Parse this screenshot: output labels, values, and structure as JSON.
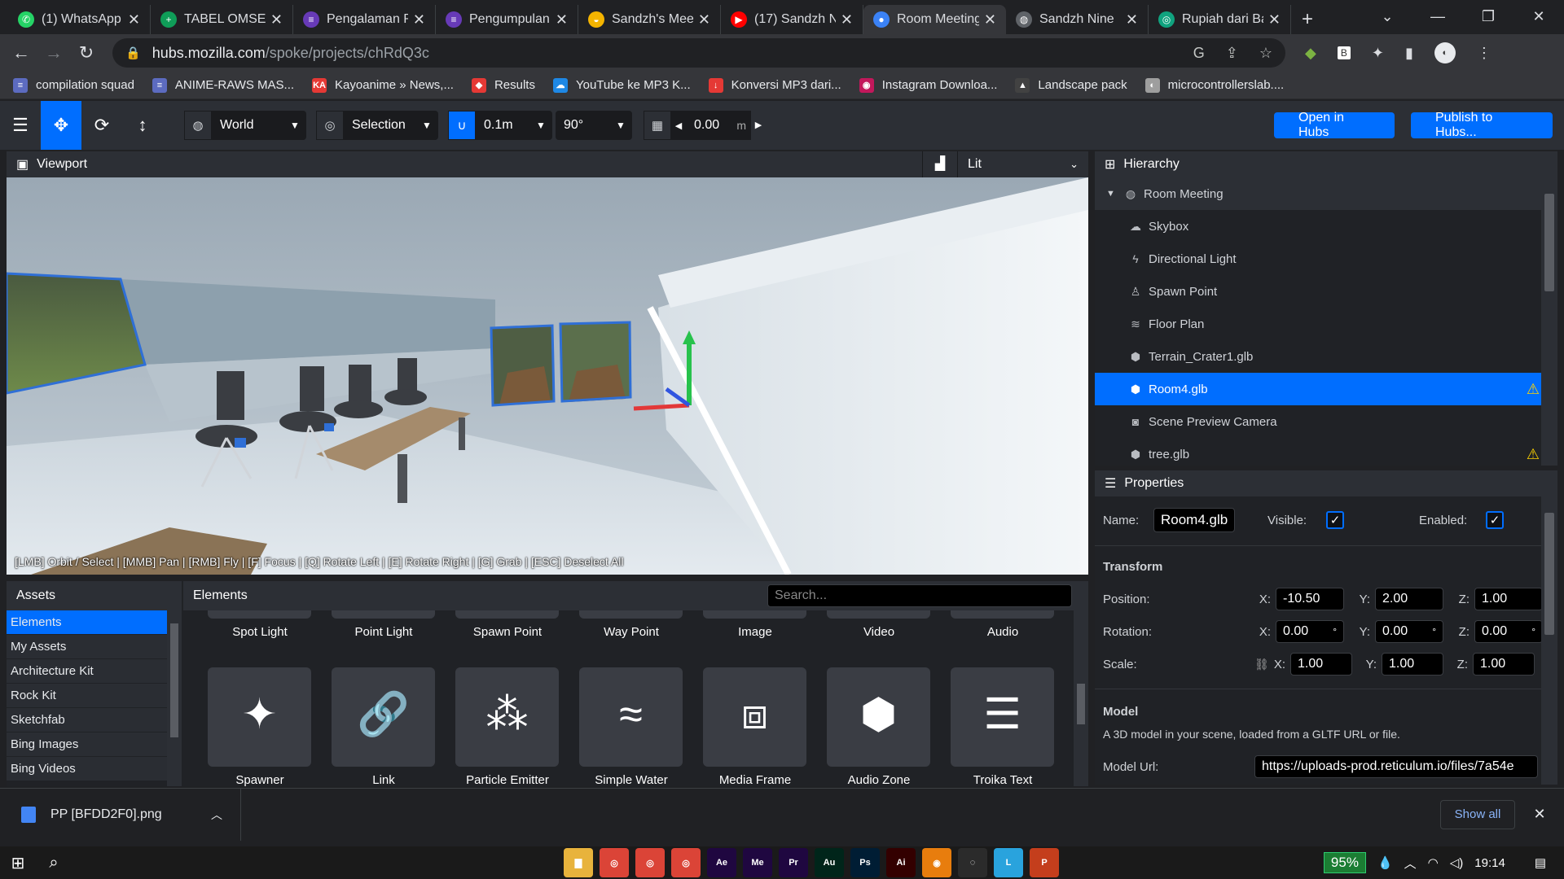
{
  "browser": {
    "tabs": [
      {
        "title": "(1) WhatsApp",
        "color": "#25d366",
        "glyph": "✆"
      },
      {
        "title": "TABEL OMSET",
        "color": "#0f9d58",
        "glyph": "+"
      },
      {
        "title": "Pengalaman R",
        "color": "#673ab7",
        "glyph": "≡"
      },
      {
        "title": "Pengumpulan",
        "color": "#673ab7",
        "glyph": "≡"
      },
      {
        "title": "Sandzh's Meet",
        "color": "#f4b400",
        "glyph": "◒"
      },
      {
        "title": "(17) Sandzh N",
        "color": "#ff0000",
        "glyph": "▶"
      },
      {
        "title": "Room Meeting",
        "color": "#3b82f6",
        "glyph": "●"
      },
      {
        "title": "Sandzh Nine",
        "color": "#5f6368",
        "glyph": "◍"
      },
      {
        "title": "Rupiah dari Ba",
        "color": "#10a37f",
        "glyph": "◎"
      }
    ],
    "active_tab": 6,
    "url_host": "hubs.mozilla.com",
    "url_path": "/spoke/projects/chRdQ3c",
    "bookmarks": [
      {
        "label": "compilation squad",
        "color": "#5c6bc0",
        "glyph": "≡"
      },
      {
        "label": "ANIME-RAWS MAS...",
        "color": "#5c6bc0",
        "glyph": "≡"
      },
      {
        "label": "Kayoanime » News,...",
        "color": "#e53935",
        "glyph": "KA"
      },
      {
        "label": "Results",
        "color": "#e53935",
        "glyph": "◆"
      },
      {
        "label": "YouTube ke MP3 K...",
        "color": "#1e88e5",
        "glyph": "☁"
      },
      {
        "label": "Konversi MP3 dari...",
        "color": "#e53935",
        "glyph": "↓"
      },
      {
        "label": "Instagram Downloa...",
        "color": "#c2185b",
        "glyph": "◉"
      },
      {
        "label": "Landscape pack",
        "color": "#424242",
        "glyph": "▲"
      },
      {
        "label": "microcontrollerslab....",
        "color": "#9e9e9e",
        "glyph": "◐"
      }
    ]
  },
  "toolbar": {
    "space": "World",
    "transform_pivot": "Selection",
    "snap_translate": "0.1m",
    "snap_rotate": "90°",
    "grid_value": "0.00",
    "grid_unit": "m",
    "open_in_hubs": "Open in Hubs",
    "publish": "Publish to Hubs..."
  },
  "viewport": {
    "title": "Viewport",
    "render_mode": "Lit",
    "help_text": "[LMB] Orbit / Select | [MMB] Pan | [RMB] Fly | [F] Focus | [Q] Rotate Left | [E] Rotate Right | [G] Grab | [ESC] Deselect All"
  },
  "hierarchy": {
    "title": "Hierarchy",
    "root": "Room Meeting",
    "items": [
      {
        "label": "Skybox",
        "icon": "cloud-icon",
        "glyph": "☁",
        "selected": false,
        "warning": false
      },
      {
        "label": "Directional Light",
        "icon": "bolt-icon",
        "glyph": "ϟ",
        "selected": false,
        "warning": false
      },
      {
        "label": "Spawn Point",
        "icon": "person-icon",
        "glyph": "♙",
        "selected": false,
        "warning": false
      },
      {
        "label": "Floor Plan",
        "icon": "shoe-prints-icon",
        "glyph": "≋",
        "selected": false,
        "warning": false
      },
      {
        "label": "Terrain_Crater1.glb",
        "icon": "cube-icon",
        "glyph": "⬢",
        "selected": false,
        "warning": false
      },
      {
        "label": "Room4.glb",
        "icon": "cube-icon",
        "glyph": "⬢",
        "selected": true,
        "warning": true
      },
      {
        "label": "Scene Preview Camera",
        "icon": "camera-icon",
        "glyph": "◙",
        "selected": false,
        "warning": false
      },
      {
        "label": "tree.glb",
        "icon": "cube-icon",
        "glyph": "⬢",
        "selected": false,
        "warning": true
      }
    ]
  },
  "properties": {
    "title": "Properties",
    "name_label": "Name:",
    "name_value": "Room4.glb",
    "visible_label": "Visible:",
    "enabled_label": "Enabled:",
    "transform_title": "Transform",
    "position_label": "Position:",
    "rotation_label": "Rotation:",
    "scale_label": "Scale:",
    "position": {
      "x": "-10.50",
      "y": "2.00",
      "z": "1.00"
    },
    "rotation": {
      "x": "0.00",
      "y": "0.00",
      "z": "0.00"
    },
    "scale": {
      "x": "1.00",
      "y": "1.00",
      "z": "1.00"
    },
    "degree_sign": "°",
    "axis_x": "X:",
    "axis_y": "Y:",
    "axis_z": "Z:",
    "model_title": "Model",
    "model_desc": "A 3D model in your scene, loaded from a GLTF URL or file.",
    "model_url_label": "Model Url:",
    "model_url": "https://uploads-prod.reticulum.io/files/7a54e"
  },
  "assets": {
    "title": "Assets",
    "sources": [
      "Elements",
      "My Assets",
      "Architecture Kit",
      "Rock Kit",
      "Sketchfab",
      "Bing Images",
      "Bing Videos"
    ],
    "elements_title": "Elements",
    "search_placeholder": "Search...",
    "row1": [
      "Spot Light",
      "Point Light",
      "Spawn Point",
      "Way Point",
      "Image",
      "Video",
      "Audio"
    ],
    "row2": [
      {
        "label": "Spawner",
        "icon": "magic-wand-icon",
        "glyph": "✦"
      },
      {
        "label": "Link",
        "icon": "link-icon",
        "glyph": "🔗"
      },
      {
        "label": "Particle Emitter",
        "icon": "spray-can-icon",
        "glyph": "⁂"
      },
      {
        "label": "Simple Water",
        "icon": "water-icon",
        "glyph": "≈"
      },
      {
        "label": "Media Frame",
        "icon": "media-frame-icon",
        "glyph": "⧈"
      },
      {
        "label": "Audio Zone",
        "icon": "cube-icon",
        "glyph": "⬢"
      },
      {
        "label": "Troika Text",
        "icon": "text-align-icon",
        "glyph": "☰"
      }
    ]
  },
  "downloads": {
    "file": "PP [BFDD2F0].png",
    "show_all": "Show all"
  },
  "taskbar": {
    "apps": [
      {
        "label": "▇",
        "color": "#e8b33c"
      },
      {
        "label": "◎",
        "color": "#db4437"
      },
      {
        "label": "◎",
        "color": "#db4437"
      },
      {
        "label": "◎",
        "color": "#db4437"
      },
      {
        "label": "Ae",
        "color": "#1f0740"
      },
      {
        "label": "Me",
        "color": "#1f0740"
      },
      {
        "label": "Pr",
        "color": "#1f0740"
      },
      {
        "label": "Au",
        "color": "#00251a"
      },
      {
        "label": "Ps",
        "color": "#001d34"
      },
      {
        "label": "Ai",
        "color": "#330000"
      },
      {
        "label": "◉",
        "color": "#e87d0d"
      },
      {
        "label": "◌",
        "color": "#2b2b2b"
      },
      {
        "label": "L",
        "color": "#29a3dd"
      },
      {
        "label": "P",
        "color": "#c43e1c"
      }
    ],
    "battery": "95%",
    "time": "19:14"
  }
}
